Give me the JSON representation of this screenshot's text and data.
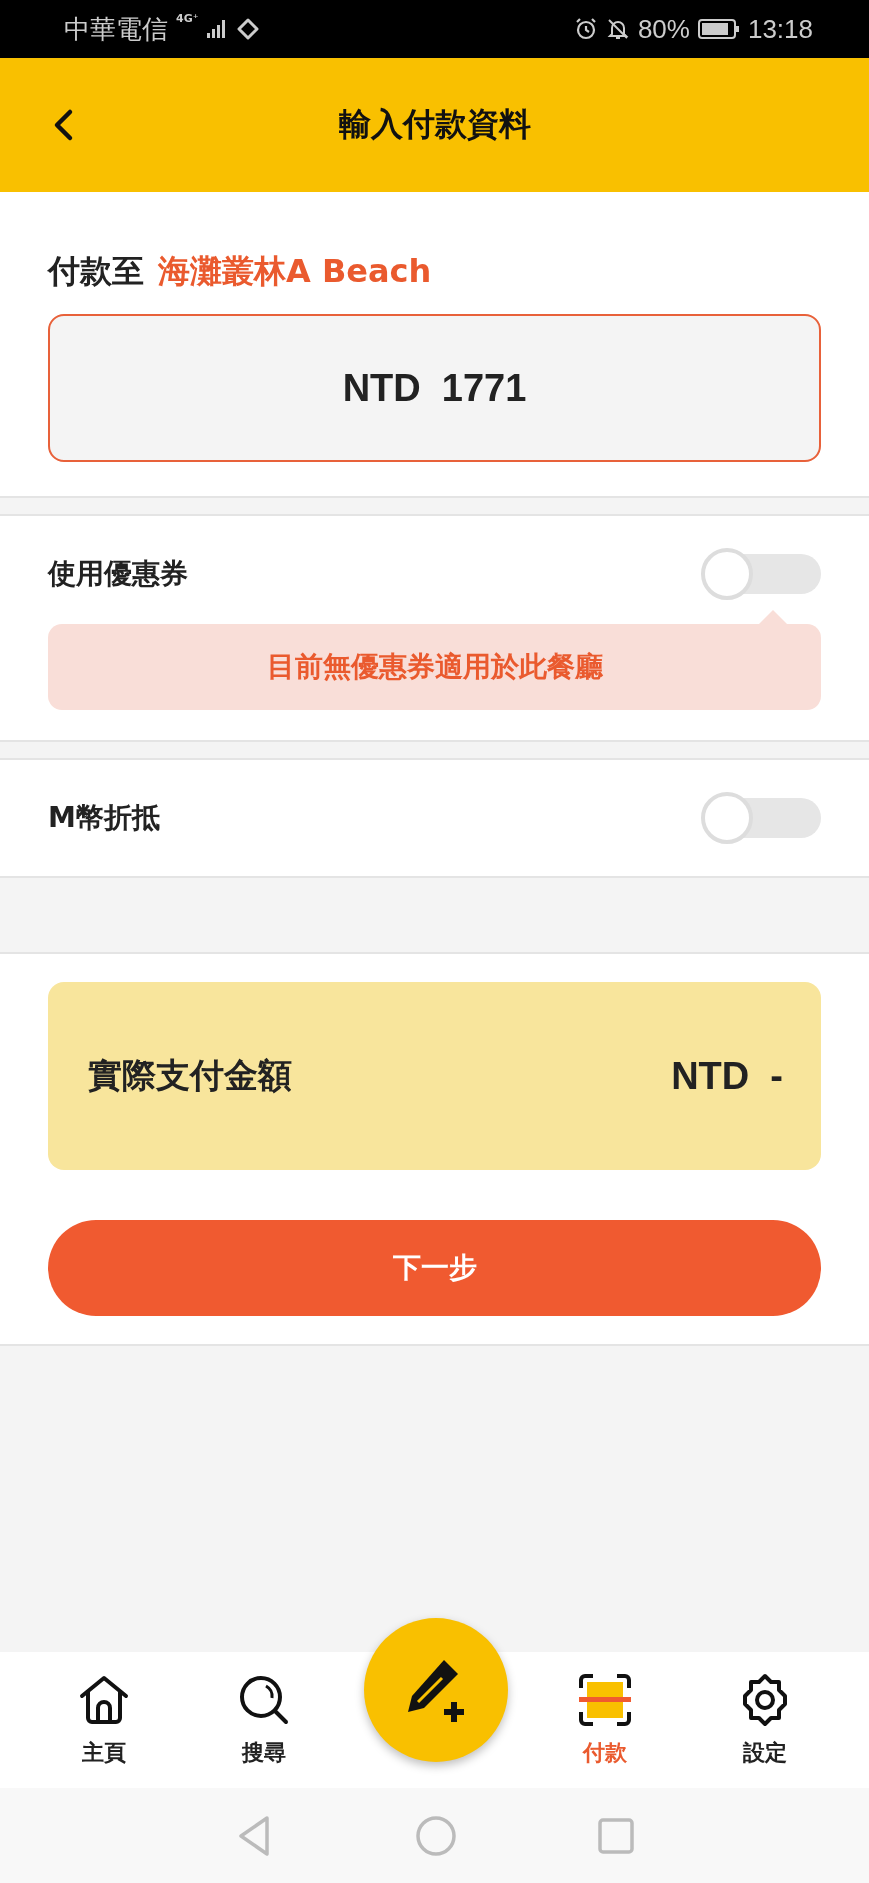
{
  "status_bar": {
    "carrier": "中華電信",
    "network": "4G⁺",
    "battery": "80%",
    "time": "13:18"
  },
  "header": {
    "title": "輸入付款資料"
  },
  "payee": {
    "label": "付款至",
    "name": "海灘叢林A Beach"
  },
  "amount": {
    "value": "NTD  1771"
  },
  "options": [
    {
      "label": "使用優惠券",
      "on": false,
      "notice": "目前無優惠券適用於此餐廳"
    },
    {
      "label": "M幣折抵",
      "on": false
    }
  ],
  "total": {
    "label": "實際支付金額",
    "value": "NTD  -"
  },
  "next_button": "下一步",
  "nav": [
    {
      "label": "主頁",
      "kind": "home",
      "selected": false
    },
    {
      "label": "搜尋",
      "kind": "search",
      "selected": false
    },
    {
      "label": "付款",
      "kind": "pay",
      "selected": true
    },
    {
      "label": "設定",
      "kind": "settings",
      "selected": false
    }
  ]
}
